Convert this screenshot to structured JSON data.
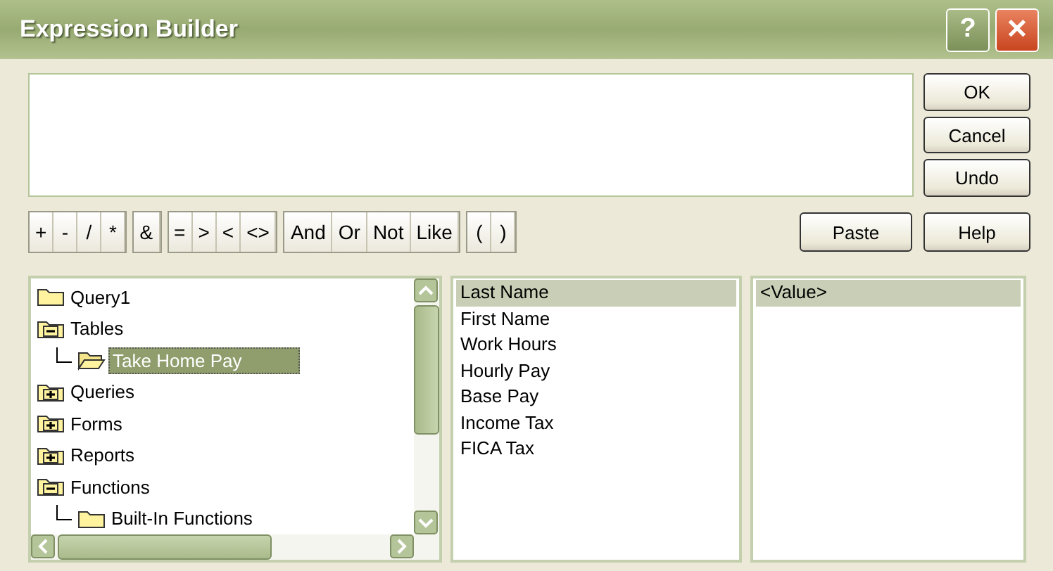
{
  "window": {
    "title": "Expression Builder",
    "help_button": "?",
    "close_button": "✕"
  },
  "side_buttons": [
    "OK",
    "Cancel",
    "Undo"
  ],
  "operator_groups": [
    [
      "+",
      "-",
      "/",
      "*"
    ],
    [
      "&"
    ],
    [
      "=",
      ">",
      "<",
      "<>"
    ],
    [
      "And",
      "Or",
      "Not",
      "Like"
    ],
    [
      "(",
      ")"
    ]
  ],
  "paste_button": "Paste",
  "help_button": "Help",
  "tree": {
    "items": [
      {
        "label": "Query1",
        "kind": "folder",
        "selected": false
      },
      {
        "label": "Tables",
        "kind": "expandable",
        "expanded": true,
        "selected": false,
        "children": [
          {
            "label": "Take Home Pay",
            "kind": "folder",
            "selected": true
          }
        ]
      },
      {
        "label": "Queries",
        "kind": "expandable",
        "expanded": false,
        "selected": false
      },
      {
        "label": "Forms",
        "kind": "expandable",
        "expanded": false,
        "selected": false
      },
      {
        "label": "Reports",
        "kind": "expandable",
        "expanded": false,
        "selected": false
      },
      {
        "label": "Functions",
        "kind": "expandable",
        "expanded": true,
        "selected": false,
        "children": [
          {
            "label": "Built-In Functions",
            "kind": "folder",
            "selected": false
          }
        ]
      }
    ]
  },
  "fields": [
    {
      "label": "Last Name",
      "selected": true
    },
    {
      "label": "First Name",
      "selected": false
    },
    {
      "label": "Work Hours",
      "selected": false
    },
    {
      "label": "Hourly Pay",
      "selected": false
    },
    {
      "label": "Base Pay",
      "selected": false
    },
    {
      "label": "Income Tax",
      "selected": false
    },
    {
      "label": "FICA Tax",
      "selected": false
    }
  ],
  "values": [
    {
      "label": "<Value>",
      "selected": true
    }
  ]
}
